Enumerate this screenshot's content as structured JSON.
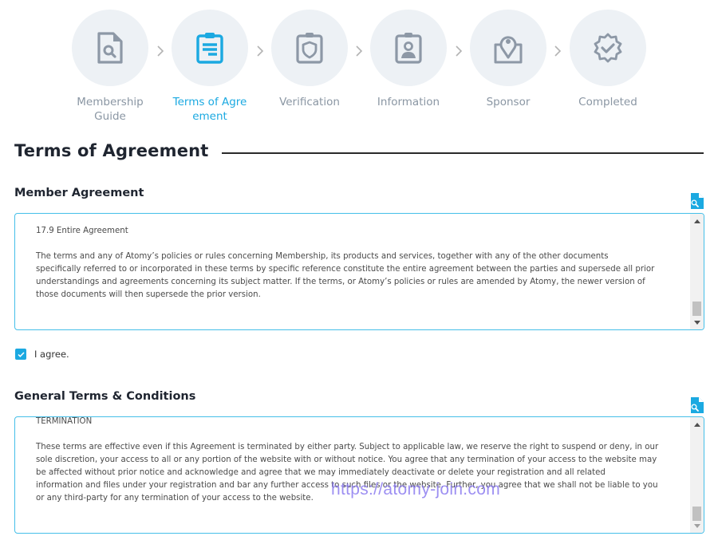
{
  "stepper": {
    "steps": [
      {
        "label": "Membership Guide",
        "icon": "document-search-icon",
        "active": false
      },
      {
        "label": "Terms of Agre ement",
        "icon": "clipboard-list-icon",
        "active": true
      },
      {
        "label": "Verification",
        "icon": "clipboard-shield-icon",
        "active": false
      },
      {
        "label": "Information",
        "icon": "id-badge-icon",
        "active": false
      },
      {
        "label": "Sponsor",
        "icon": "map-pin-icon",
        "active": false
      },
      {
        "label": "Completed",
        "icon": "badge-check-icon",
        "active": false
      }
    ]
  },
  "page": {
    "title": "Terms of Agreement"
  },
  "member_agreement": {
    "title": "Member Agreement",
    "heading": "17.9 Entire Agreement",
    "lines": [
      "The terms and any of Atomy’s policies or rules concerning Membership, its products and services, together with any of the other documents",
      "specifically referred to or incorporated in these terms by specific reference constitute the entire agreement between the parties and supersede all prior",
      "understandings and agreements concerning its subject matter. If the terms, or Atomy’s policies or rules are amended by Atomy, the newer version of",
      "those documents will then supersede the prior version."
    ],
    "agree_label": "I agree.",
    "agree_checked": true
  },
  "general_terms": {
    "title": "General Terms & Conditions",
    "heading": "TERMINATION",
    "lines": [
      "These terms are effective even if this Agreement is terminated by either party. Subject to applicable law, we reserve the right to suspend or deny, in our",
      "sole discretion, your access to all or any portion of the website with or without notice. You agree that any termination of your access to the website may",
      "be affected without prior notice and acknowledge and agree that we may immediately deactivate or delete your registration and all related",
      "information and files under your registration and bar any further access to such files or the website. Further, you agree that we shall not be liable to you",
      "or any third-party for any termination of your access to the website."
    ]
  },
  "watermark": "https://atomy-join.com",
  "colors": {
    "accent": "#1ba9e1",
    "inactive": "#8a96a3",
    "circle_bg": "#edf1f5",
    "box_border": "#45bfe9"
  }
}
